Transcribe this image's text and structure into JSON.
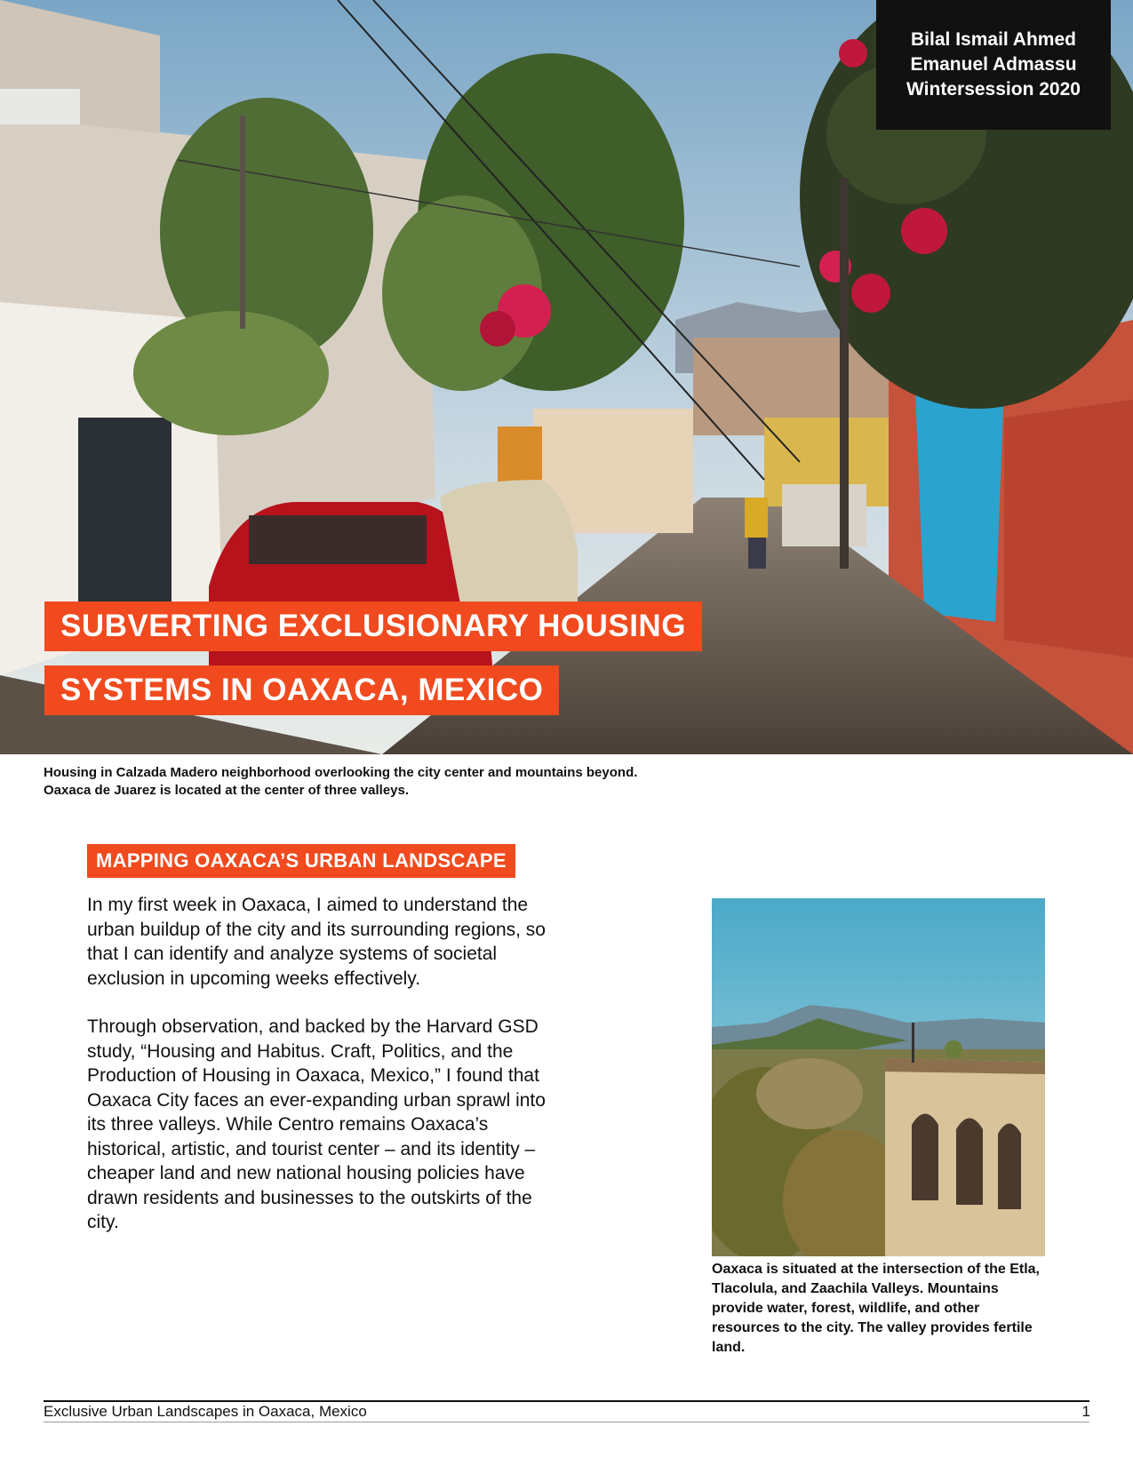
{
  "authors": {
    "line1": "Bilal Ismail Ahmed",
    "line2": "Emanuel Admassu",
    "line3": "Wintersession 2020"
  },
  "title": {
    "line1": "SUBVERTING EXCLUSIONARY HOUSING",
    "line2": "SYSTEMS IN OAXACA, MEXICO"
  },
  "hero_caption": {
    "line1": "Housing in Calzada Madero neighborhood overlooking the city center and mountains beyond.",
    "line2": "Oaxaca de Juarez is located at the center of three valleys."
  },
  "section": {
    "heading": "MAPPING OAXACA’S URBAN LANDSCAPE",
    "paragraph1": "In my first week in Oaxaca, I aimed to understand the urban buildup of the city and its surrounding regions, so that I can identify and analyze systems of societal exclusion in upcoming weeks effectively.",
    "paragraph2": "Through observation, and backed by the Harvard GSD study, “Housing and Habitus. Craft, Politics, and the Production of Housing in Oaxaca, Mexico,” I found that Oaxaca City faces an ever-expanding urban sprawl into its three valleys. While Centro remains Oaxaca’s historical, artistic, and tourist center – and its identity – cheaper land and new national housing policies have drawn residents and businesses to the outskirts of the city."
  },
  "side_caption": "Oaxaca is situated at the intersection of the Etla, Tlacolula, and Zaachila Valleys. Mountains provide water, forest, wildlife, and other resources to the city. The valley provides fertile land.",
  "footer": {
    "left": "Exclusive Urban Landscapes in Oaxaca, Mexico",
    "page_number": "1"
  },
  "colors": {
    "accent": "#f04a1e",
    "author_box": "#111111"
  }
}
